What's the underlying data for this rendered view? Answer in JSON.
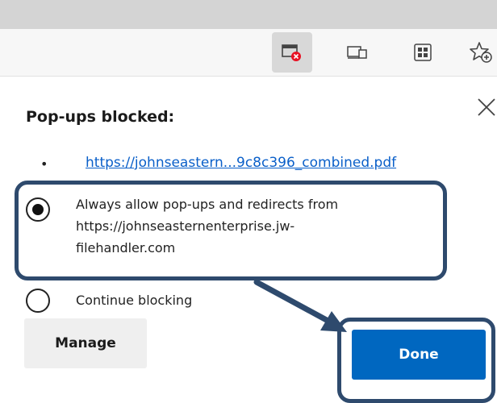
{
  "toolbar": {
    "icons": [
      "popup-blocked-icon",
      "device-icon",
      "extensions-icon",
      "favorites-add-icon"
    ]
  },
  "popup": {
    "title": "Pop-ups blocked:",
    "bullet": "•",
    "blocked_url": "https://johnseastern...9c8c396_combined.pdf",
    "close_icon": "close-icon",
    "options": [
      {
        "lines": [
          "Always allow pop-ups and redirects from",
          "https://johnseasternenterprise.jw-",
          "filehandler.com"
        ],
        "selected": true
      },
      {
        "lines": [
          "Continue blocking"
        ],
        "selected": false
      }
    ],
    "manage_label": "Manage",
    "done_label": "Done"
  },
  "colors": {
    "accent": "#0067c0",
    "link": "#0a5fc9",
    "annotation": "#2e4a6d",
    "blocked_badge": "#e81123"
  }
}
